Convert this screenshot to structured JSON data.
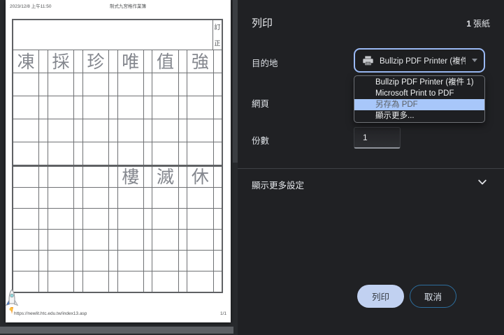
{
  "preview": {
    "page_header": {
      "date": "2023/12/8 上午11:50",
      "title": "制式九宮格作業簿"
    },
    "page_footer": {
      "url": "https://newlit.htc.edu.tw/index13.asp",
      "page_indicator": "1/1"
    },
    "sheet": {
      "correction_top": "訂",
      "correction_bottom": "正",
      "columns": 6,
      "section1_rows": [
        [
          "凍",
          "採",
          "珍",
          "唯",
          "值",
          "強"
        ],
        [
          "",
          "",
          "",
          "",
          "",
          ""
        ],
        [
          "",
          "",
          "",
          "",
          "",
          ""
        ],
        [
          "",
          "",
          "",
          "",
          "",
          ""
        ],
        [
          "",
          "",
          "",
          "",
          "",
          ""
        ]
      ],
      "section2_rows": [
        [
          "",
          "",
          "",
          "樓",
          "滅",
          "休"
        ],
        [
          "",
          "",
          "",
          "",
          "",
          ""
        ],
        [
          "",
          "",
          "",
          "",
          "",
          ""
        ],
        [
          "",
          "",
          "",
          "",
          "",
          ""
        ],
        [
          "",
          "",
          "",
          "",
          "",
          ""
        ],
        [
          "",
          "",
          "",
          "",
          "",
          ""
        ]
      ]
    }
  },
  "panel": {
    "title": "列印",
    "sheet_count_number": "1",
    "sheet_count_unit": "張紙",
    "destination_label": "目的地",
    "destination_value": "Bullzip PDF Printer (複件",
    "destination_menu": {
      "options": [
        "Bullzip PDF Printer (複件 1)",
        "Microsoft Print to PDF",
        "另存為 PDF",
        "顯示更多..."
      ],
      "highlighted_index": 2
    },
    "pages_label": "網頁",
    "copies_label": "份數",
    "copies_value": "1",
    "more_settings_label": "顯示更多設定",
    "print_button": "列印",
    "cancel_button": "取消"
  },
  "icons": {
    "printer": "printer-icon",
    "select_caret": "caret-down-icon",
    "more_settings": "chevron-down-icon",
    "page_logo": "rocket-icon"
  },
  "colors": {
    "panel_bg": "#202124",
    "preview_bg": "#282a2d",
    "accent_focus_ring": "#9ab9f4",
    "menu_highlight": "#a8c7fa",
    "print_button_bg": "#c1d1f1",
    "cancel_button_border": "#2d6e9e",
    "text_primary": "#e8eaed"
  }
}
